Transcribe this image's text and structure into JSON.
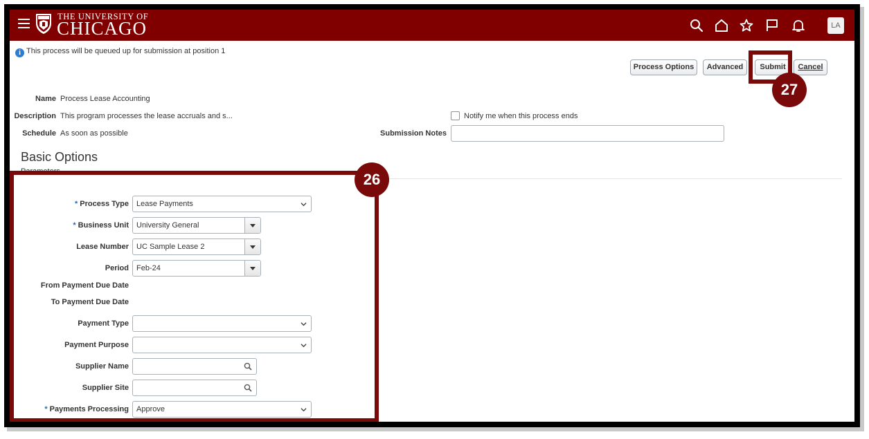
{
  "header": {
    "logo_top": "THE UNIVERSITY OF",
    "logo_main": "CHICAGO",
    "avatar": "LA",
    "brand_color": "#800000",
    "icons": [
      "menu-icon",
      "search-icon",
      "home-icon",
      "favorites-star-icon",
      "flag-icon",
      "bell-icon"
    ]
  },
  "info_message": "This process will be queued up for submission at position 1",
  "actions": {
    "process_options": "Process Options",
    "advanced": "Advanced",
    "submit": "Submit",
    "cancel": "Cancel"
  },
  "details": {
    "name_label": "Name",
    "name_value": "Process Lease Accounting",
    "description_label": "Description",
    "description_value": "This program processes the lease accruals and s...",
    "schedule_label": "Schedule",
    "schedule_value": "As soon as possible",
    "notify_label": "Notify me when this process ends",
    "notify_checked": false,
    "submission_notes_label": "Submission Notes",
    "submission_notes_value": ""
  },
  "basic_options": {
    "title": "Basic Options",
    "parameters_label": "Parameters"
  },
  "parameters": {
    "process_type_label": "Process Type",
    "process_type_value": "Lease Payments",
    "business_unit_label": "Business Unit",
    "business_unit_value": "University General",
    "lease_number_label": "Lease Number",
    "lease_number_value": "UC Sample Lease 2",
    "period_label": "Period",
    "period_value": "Feb-24",
    "from_payment_due_date_label": "From Payment Due Date",
    "to_payment_due_date_label": "To Payment Due Date",
    "payment_type_label": "Payment Type",
    "payment_type_value": "",
    "payment_purpose_label": "Payment Purpose",
    "payment_purpose_value": "",
    "supplier_name_label": "Supplier Name",
    "supplier_name_value": "",
    "supplier_site_label": "Supplier Site",
    "supplier_site_value": "",
    "payments_processing_label": "Payments Processing",
    "payments_processing_value": "Approve",
    "required_marker": "*"
  },
  "callouts": {
    "step_26": "26",
    "step_27": "27",
    "color": "#7a0a0a"
  }
}
